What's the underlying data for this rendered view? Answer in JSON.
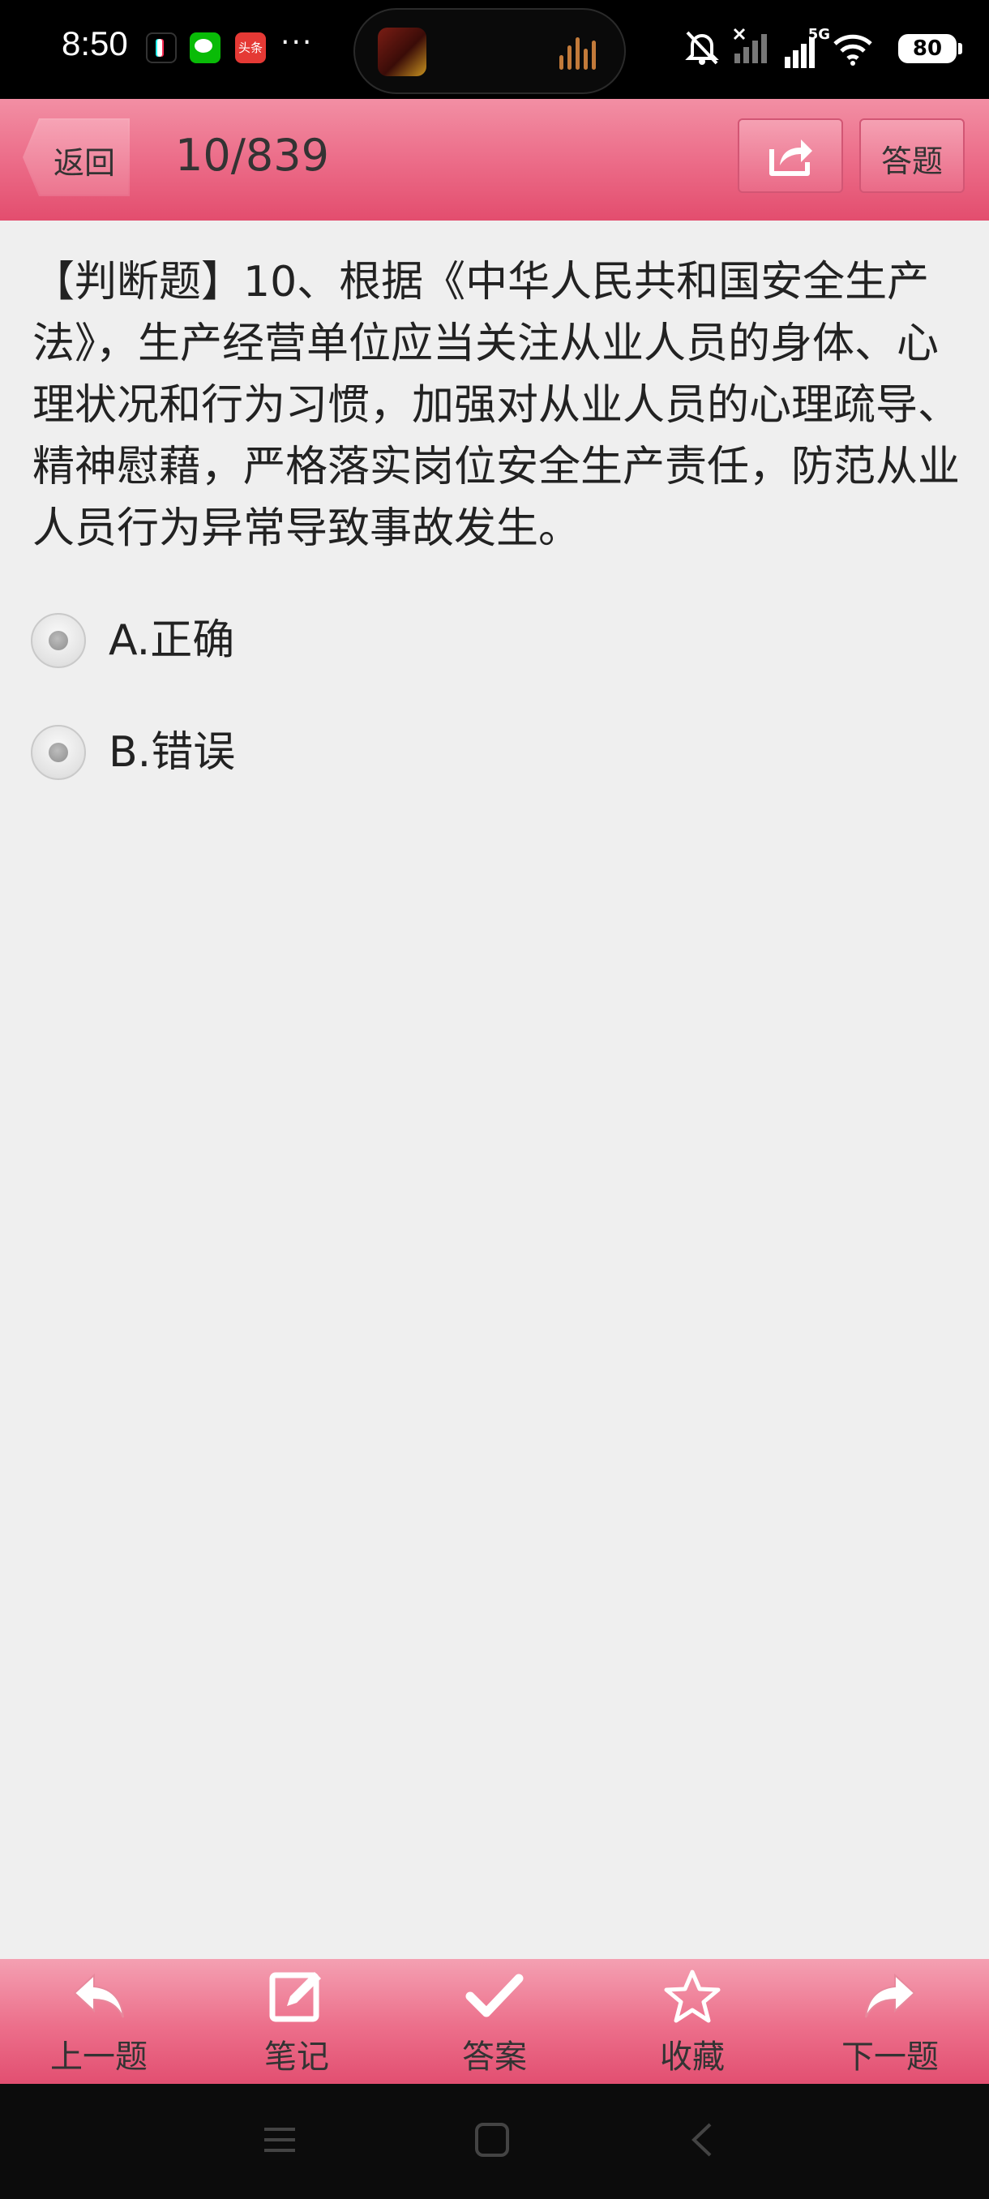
{
  "status_bar": {
    "time": "8:50",
    "toutiao_label": "头条",
    "more": "···",
    "network": "5G",
    "battery": "80"
  },
  "header": {
    "back_label": "返回",
    "progress": "10/839",
    "answer_mode_label": "答题"
  },
  "question": {
    "text": "【判断题】10、根据《中华人民共和国安全生产法》，生产经营单位应当关注从业人员的身体、心理状况和行为习惯，加强对从业人员的心理疏导、精神慰藉，严格落实岗位安全生产责任，防范从业人员行为异常导致事故发生。",
    "options": [
      {
        "label": "A.正确"
      },
      {
        "label": "B.错误"
      }
    ]
  },
  "toolbar": {
    "items": [
      {
        "label": "上一题",
        "icon": "reply-arrow-icon"
      },
      {
        "label": "笔记",
        "icon": "edit-note-icon"
      },
      {
        "label": "答案",
        "icon": "checkmark-icon"
      },
      {
        "label": "收藏",
        "icon": "star-icon"
      },
      {
        "label": "下一题",
        "icon": "forward-arrow-icon"
      }
    ]
  },
  "colors": {
    "accent": "#ec6d89",
    "background": "#efefef",
    "text": "#222222"
  }
}
